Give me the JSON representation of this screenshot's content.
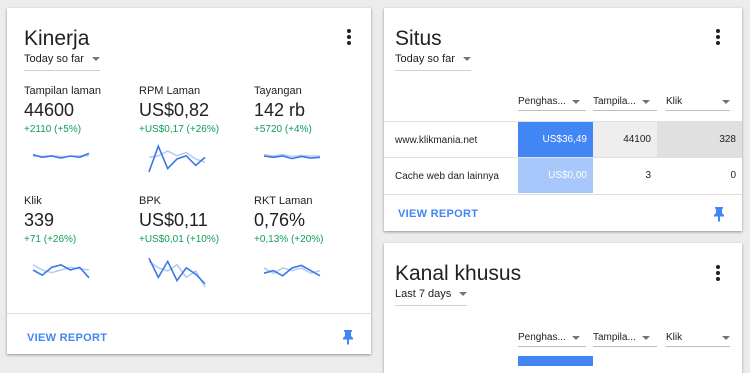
{
  "kinerja": {
    "title": "Kinerja",
    "range": "Today so far",
    "metrics": [
      {
        "label": "Tampilan laman",
        "value": "44600",
        "delta": "+2110 (+5%)",
        "spark": {
          "today": [
            0.55,
            0.45,
            0.5,
            0.42,
            0.5,
            0.45,
            0.6
          ],
          "prev": [
            0.5,
            0.48,
            0.52,
            0.47,
            0.5,
            0.5,
            0.52
          ]
        }
      },
      {
        "label": "RPM Laman",
        "value": "US$0,82",
        "delta": "+US$0,17 (+26%)",
        "spark": {
          "today": [
            0.1,
            0.9,
            0.2,
            0.5,
            0.6,
            0.3,
            0.55
          ],
          "prev": [
            0.55,
            0.6,
            0.75,
            0.6,
            0.7,
            0.5,
            0.4
          ]
        }
      },
      {
        "label": "Tayangan",
        "value": "142 rb",
        "delta": "+5720 (+4%)",
        "spark": {
          "today": [
            0.5,
            0.45,
            0.5,
            0.4,
            0.48,
            0.42,
            0.45
          ],
          "prev": [
            0.55,
            0.5,
            0.55,
            0.48,
            0.52,
            0.5,
            0.5
          ]
        }
      },
      {
        "label": "Klik",
        "value": "339",
        "delta": "+71 (+26%)",
        "spark": {
          "today": [
            0.5,
            0.3,
            0.6,
            0.7,
            0.5,
            0.6,
            0.2
          ],
          "prev": [
            0.7,
            0.5,
            0.4,
            0.5,
            0.6,
            0.55,
            0.5
          ]
        }
      },
      {
        "label": "BPK",
        "value": "US$0,11",
        "delta": "+US$0,01 (+10%)",
        "spark": {
          "today": [
            0.9,
            0.3,
            0.8,
            0.2,
            0.6,
            0.4,
            0.1
          ],
          "prev": [
            0.8,
            0.6,
            0.5,
            0.7,
            0.3,
            0.5,
            0.0
          ]
        }
      },
      {
        "label": "RKT Laman",
        "value": "0,76%",
        "delta": "+0,13% (+20%)",
        "spark": {
          "today": [
            0.3,
            0.4,
            0.2,
            0.5,
            0.6,
            0.4,
            0.2
          ],
          "prev": [
            0.5,
            0.3,
            0.5,
            0.4,
            0.5,
            0.3,
            0.4
          ]
        }
      }
    ],
    "view_report": "VIEW REPORT"
  },
  "situs": {
    "title": "Situs",
    "range": "Today so far",
    "columns": [
      "Penghas...",
      "Tampila...",
      "Klik"
    ],
    "rows": [
      {
        "label": "www.klikmania.net",
        "values": [
          "US$36,49",
          "44100",
          "328"
        ]
      },
      {
        "label": "Cache web dan lainnya",
        "values": [
          "US$0,00",
          "3",
          "0"
        ]
      }
    ],
    "view_report": "VIEW REPORT"
  },
  "kanal": {
    "title": "Kanal khusus",
    "range": "Last 7 days",
    "columns": [
      "Penghas...",
      "Tampila...",
      "Klik"
    ]
  },
  "colors": {
    "accent": "#4285f4",
    "positive": "#0f9d58",
    "bar_dark": "#4285f4",
    "bar_light": "#a8c7fa",
    "spark_today": "#3b78e7",
    "spark_prev": "#b5ccf5"
  }
}
